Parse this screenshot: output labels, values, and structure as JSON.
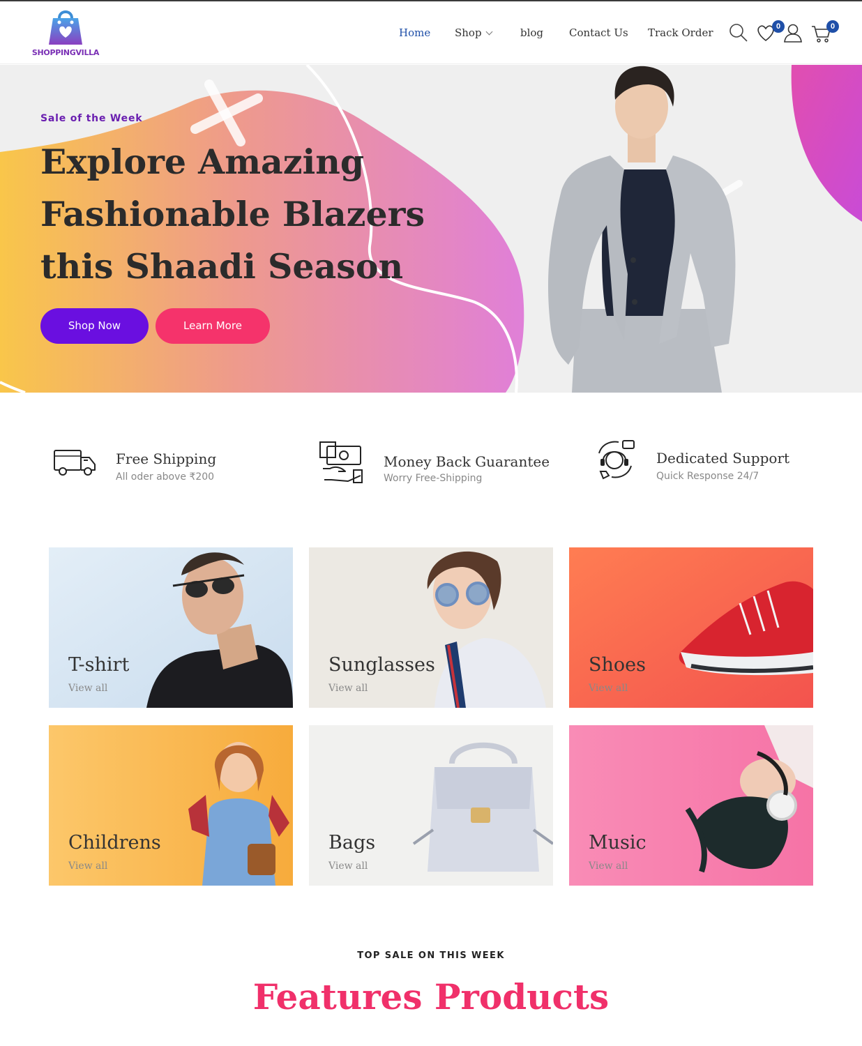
{
  "brand": {
    "name": "SHOPPINGVILLA",
    "icon": "shopping-bag-heart-logo"
  },
  "nav": {
    "items": [
      {
        "label": "Home",
        "active": true
      },
      {
        "label": "Shop",
        "has_dropdown": true
      },
      {
        "label": "blog"
      },
      {
        "label": "Contact Us"
      },
      {
        "label": "Track Order"
      }
    ]
  },
  "header_icons": {
    "search": "search-icon",
    "wishlist": {
      "icon": "heart-icon",
      "count": "0"
    },
    "account": "user-icon",
    "cart": {
      "icon": "cart-icon",
      "count": "0"
    }
  },
  "hero": {
    "eyebrow": "Sale of the Week",
    "title_lines": [
      "Explore Amazing",
      "Fashionable Blazers",
      "this Shaadi Season"
    ],
    "primary_button": "Shop Now",
    "secondary_button": "Learn More"
  },
  "features": [
    {
      "icon": "truck-icon",
      "title": "Free Shipping",
      "subtitle": "All oder above ₹200"
    },
    {
      "icon": "money-hand-icon",
      "title": "Money Back Guarantee",
      "subtitle": "Worry Free-Shipping"
    },
    {
      "icon": "support-headset-icon",
      "title": "Dedicated Support",
      "subtitle": "Quick Response 24/7"
    }
  ],
  "categories": [
    {
      "title": "T-shirt",
      "link": "View all"
    },
    {
      "title": "Sunglasses",
      "link": "View all"
    },
    {
      "title": "Shoes",
      "link": "View all"
    },
    {
      "title": "Childrens",
      "link": "View all"
    },
    {
      "title": "Bags",
      "link": "View all"
    },
    {
      "title": "Music",
      "link": "View all"
    }
  ],
  "featured_section": {
    "eyebrow": "TOP SALE ON THIS WEEK",
    "title": "Features Products"
  },
  "colors": {
    "primary": "#6a0fe0",
    "secondary": "#f5336b",
    "nav_active": "#1f4fa8",
    "heading_accent": "#f0306a",
    "brand_purple": "#7a2fb5"
  }
}
